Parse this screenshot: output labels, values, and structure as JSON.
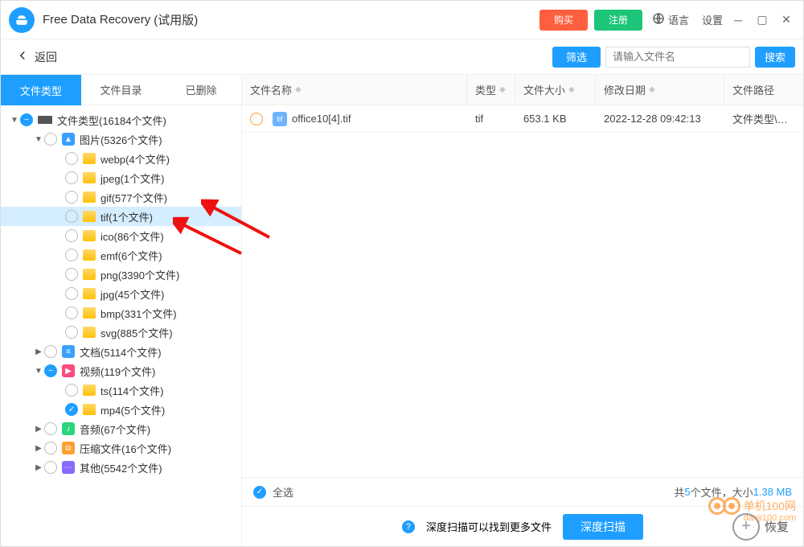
{
  "titlebar": {
    "app_name": "Free Data Recovery",
    "trial_suffix": "(试用版)",
    "buy": "购买",
    "register": "注册",
    "language": "语言",
    "settings": "设置"
  },
  "toolbar": {
    "back": "返回",
    "filter": "筛选",
    "search_placeholder": "请输入文件名",
    "search": "搜索"
  },
  "tabs": {
    "type": "文件类型",
    "dir": "文件目录",
    "deleted": "已删除"
  },
  "tree": {
    "root": "文件类型(16184个文件)",
    "images": "图片(5326个文件)",
    "img_children": [
      "webp(4个文件)",
      "jpeg(1个文件)",
      "gif(577个文件)",
      "tif(1个文件)",
      "ico(86个文件)",
      "emf(6个文件)",
      "png(3390个文件)",
      "jpg(45个文件)",
      "bmp(331个文件)",
      "svg(885个文件)"
    ],
    "docs": "文档(5114个文件)",
    "videos": "视频(119个文件)",
    "vid_children": [
      "ts(114个文件)",
      "mp4(5个文件)"
    ],
    "audio": "音频(67个文件)",
    "archive": "压缩文件(16个文件)",
    "other": "其他(5542个文件)"
  },
  "columns": {
    "name": "文件名称",
    "type": "类型",
    "size": "文件大小",
    "date": "修改日期",
    "path": "文件路径"
  },
  "rows": [
    {
      "name": "office10[4].tif",
      "type": "tif",
      "size": "653.1 KB",
      "date": "2022-12-28 09:42:13",
      "path": "文件类型\\图片\\tif\\"
    }
  ],
  "footer": {
    "select_all": "全选",
    "total_prefix": "共",
    "total_count": "5",
    "total_mid": "个文件，大小",
    "total_size": "1.38 MB",
    "deep_hint": "深度扫描可以找到更多文件",
    "deep_scan": "深度扫描",
    "recover": "恢复"
  },
  "watermark": "danji100.com",
  "watermark_label": "单机100网"
}
